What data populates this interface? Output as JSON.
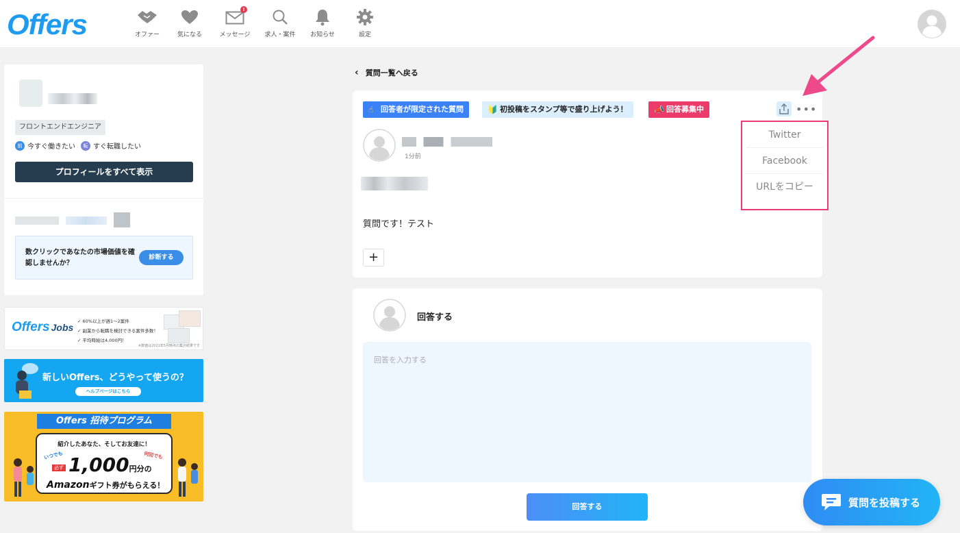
{
  "header": {
    "logo": "Offers",
    "nav": [
      {
        "label": "オファー",
        "icon": "handshake-icon"
      },
      {
        "label": "気になる",
        "icon": "heart-icon"
      },
      {
        "label": "メッセージ",
        "icon": "envelope-icon",
        "badge": "!"
      },
      {
        "label": "求人・案件",
        "icon": "search-icon"
      },
      {
        "label": "お知らせ",
        "icon": "bell-icon"
      },
      {
        "label": "設定",
        "icon": "gear-icon"
      }
    ]
  },
  "sidebar": {
    "profile": {
      "job_tag": "フロントエンドエンジニア",
      "status1_mark": "前",
      "status1": "今すぐ働きたい",
      "status2_mark": "転",
      "status2": "すぐ転職したい",
      "show_profile_button": "プロフィールをすべて表示"
    },
    "market": {
      "text": "数クリックであなたの市場価値を確認しませんか？",
      "button": "診断する"
    },
    "banners": {
      "jobs": {
        "brand": "Offers",
        "brand_sub": "Jobs",
        "points": [
          "✓ 60%以上が週1〜2案件",
          "✓ 副業から転職を検討できる案件多数！",
          "✓ 平均時給は4,000円！"
        ],
        "note": "※数値は2021年5月時点の集計結果です"
      },
      "help": {
        "title": "新しいOffers、どうやって使うの？",
        "button": "ヘルプページはこちら"
      },
      "invite": {
        "title": "Offers 招待プログラム",
        "line1": "紹介したあなた、そしてお友達に！",
        "anytime": "いつでも",
        "anywhen": "何回でも",
        "must": "必ず",
        "amount": "1,000",
        "unit": "円分の",
        "gift_brand": "Amazon",
        "gift": "ギフト券がもらえる！"
      }
    }
  },
  "main": {
    "back_link": "質問一覧へ戻る",
    "question": {
      "tags": [
        {
          "icon": "☝",
          "label": "回答者が限定された質問",
          "color": "#3b82f6",
          "text_color": "#ffffff",
          "icon_color": "#ffcc33"
        },
        {
          "icon": "🔰",
          "label": "初投稿をスタンプ等で盛り上げよう！",
          "color": "#dbeefc",
          "text_color": "#222222",
          "icon_color": "#2e9e4a"
        },
        {
          "icon": "📣",
          "label": "回答募集中",
          "color": "#ec3a6b",
          "text_color": "#ffffff",
          "icon_color": "#ffffff"
        }
      ],
      "time": "1分前",
      "body": "質問です！テスト",
      "add_stamp": "+",
      "share_menu": [
        "Twitter",
        "Facebook",
        "URLをコピー"
      ]
    },
    "answer": {
      "heading": "回答する",
      "placeholder": "回答を入力する",
      "submit": "回答する"
    }
  },
  "fab": {
    "label": "質問を投稿する"
  },
  "colors": {
    "brand": "#1d9bf0",
    "dark_button": "#263d4f",
    "annotation": "#ea3a78"
  }
}
